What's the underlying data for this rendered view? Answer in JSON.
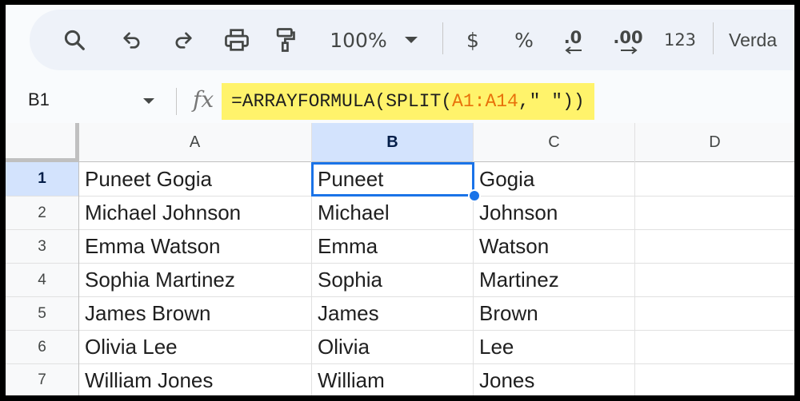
{
  "toolbar": {
    "zoom": "100%",
    "currency": "$",
    "percent": "%",
    "decrease_decimal": ".0",
    "increase_decimal": ".00",
    "number_format": "123",
    "font": "Verda"
  },
  "formula_bar": {
    "cell_ref": "B1",
    "fx": "fx",
    "formula_prefix": "=ARRAYFORMULA(SPLIT(",
    "formula_range": "A1:A14",
    "formula_suffix": ",\" \"))"
  },
  "sheet": {
    "columns": [
      "A",
      "B",
      "C",
      "D"
    ],
    "selected_column": "B",
    "selected_row": 1,
    "rows": [
      {
        "num": "1",
        "a": "Puneet Gogia",
        "b": "Puneet",
        "c": "Gogia"
      },
      {
        "num": "2",
        "a": "Michael Johnson",
        "b": "Michael",
        "c": "Johnson"
      },
      {
        "num": "3",
        "a": "Emma Watson",
        "b": "Emma",
        "c": "Watson"
      },
      {
        "num": "4",
        "a": "Sophia Martinez",
        "b": "Sophia",
        "c": "Martinez"
      },
      {
        "num": "5",
        "a": "James Brown",
        "b": "James",
        "c": "Brown"
      },
      {
        "num": "6",
        "a": "Olivia Lee",
        "b": "Olivia",
        "c": "Lee"
      },
      {
        "num": "7",
        "a": "William Jones",
        "b": "William",
        "c": "Jones"
      }
    ]
  }
}
